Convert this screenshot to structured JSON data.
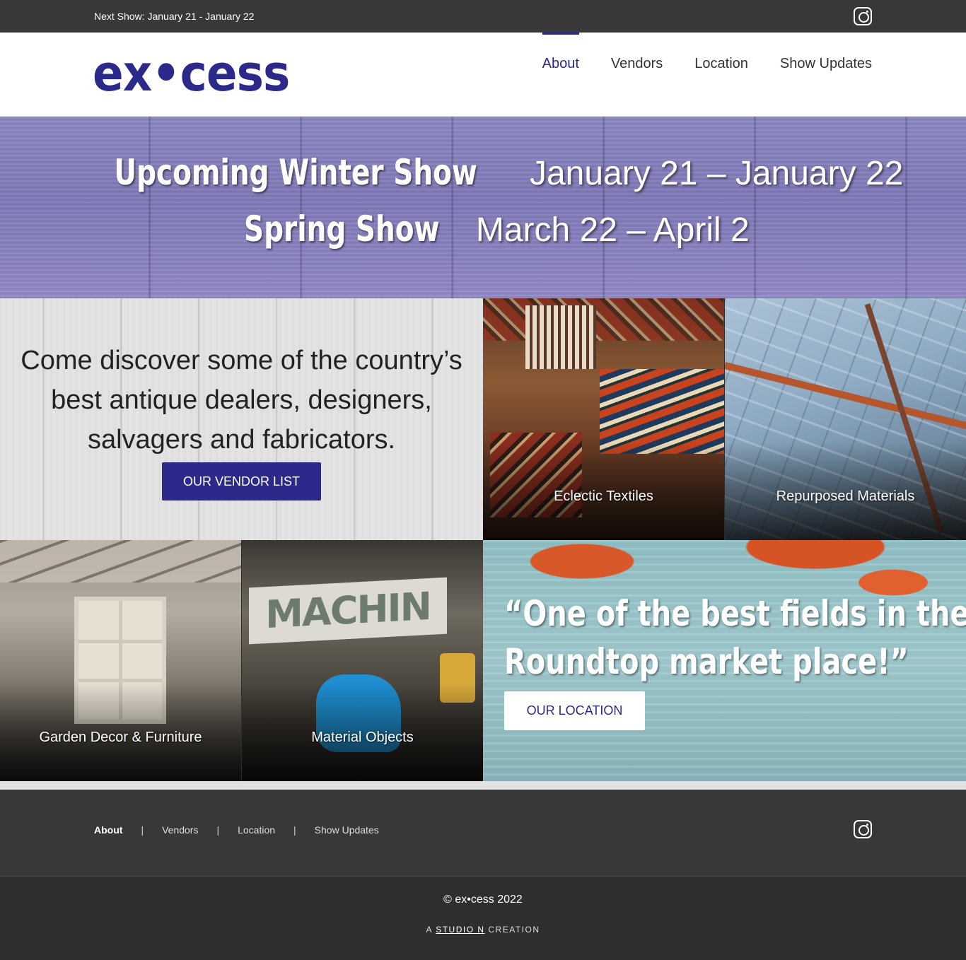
{
  "topbar": {
    "next_show": "Next Show: January 21 - January 22"
  },
  "brand": {
    "logo": "ex•cess",
    "color": "#2b2a8a"
  },
  "nav": {
    "items": [
      "About",
      "Vendors",
      "Location",
      "Show Updates"
    ],
    "active": "About"
  },
  "hero": {
    "show1": {
      "name": "Upcoming Winter Show",
      "dates": "January 21 – January 22"
    },
    "show2": {
      "name": "Spring Show",
      "dates": "March 22 – April 2"
    }
  },
  "intro": {
    "text": "Come discover some of the country’s best antique dealers, designers, salvagers and fabricators.",
    "button": "OUR VENDOR LIST"
  },
  "categories": [
    "Eclectic Textiles",
    "Repurposed Materials",
    "Garden Decor & Furniture",
    "Material Objects"
  ],
  "photo_sign_text": "MACHIN",
  "quote": {
    "line1": "“One of the best fields in the",
    "line2": "Roundtop market place!”",
    "button": "OUR LOCATION"
  },
  "footer": {
    "nav": [
      "About",
      "Vendors",
      "Location",
      "Show Updates"
    ],
    "divider": "|",
    "copyright": "© ex•cess 2022",
    "credit_pre": "A ",
    "credit_link": "STUDIO N",
    "credit_post": " CREATION"
  },
  "icons": {
    "social": "instagram-icon"
  }
}
